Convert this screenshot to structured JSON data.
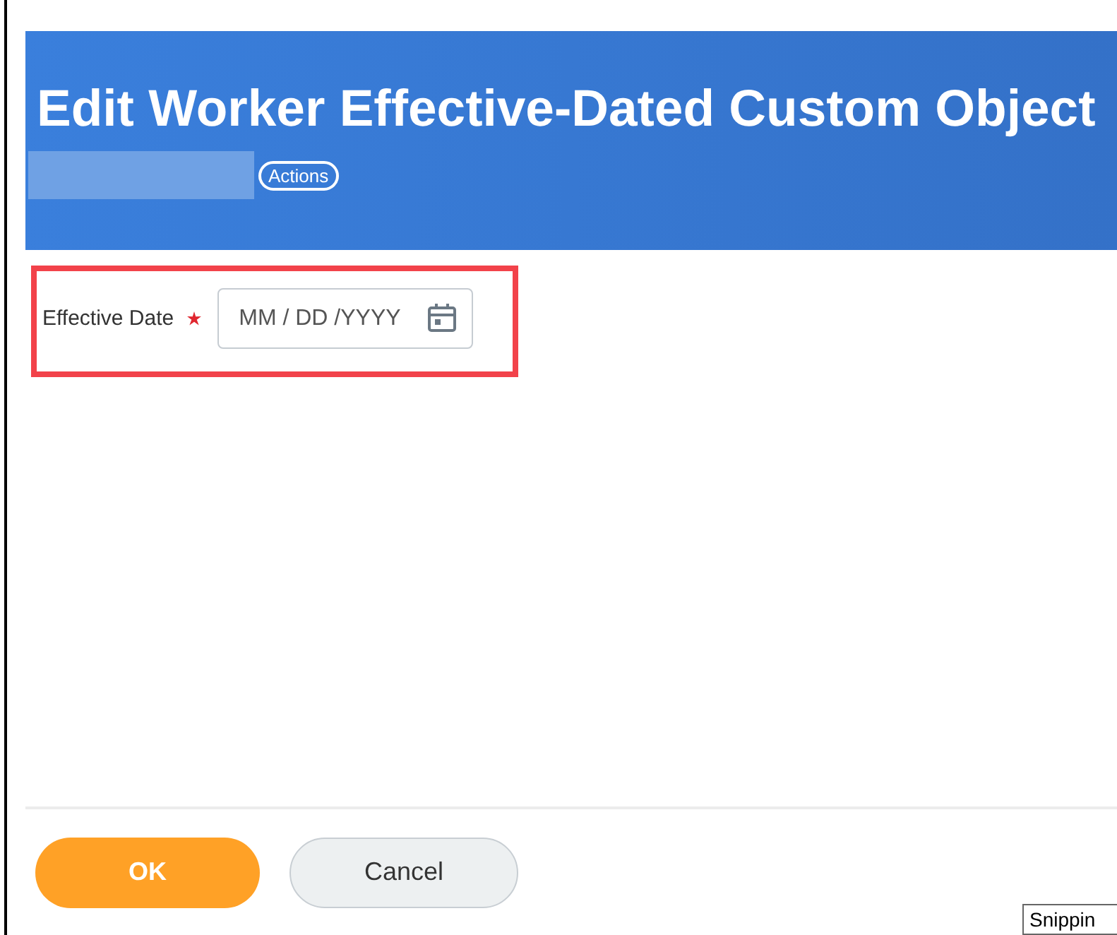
{
  "header": {
    "title": "Edit Worker Effective-Dated Custom Object",
    "actions_button": "Actions"
  },
  "form": {
    "field_label": "Effective Date",
    "required": true,
    "placeholder": "MM / DD /YYYY",
    "highlighted": true
  },
  "buttons": [
    {
      "label": "OK",
      "kind": "primary"
    },
    {
      "label": "Cancel",
      "kind": "secondary"
    }
  ],
  "tooltip": "Snippin"
}
